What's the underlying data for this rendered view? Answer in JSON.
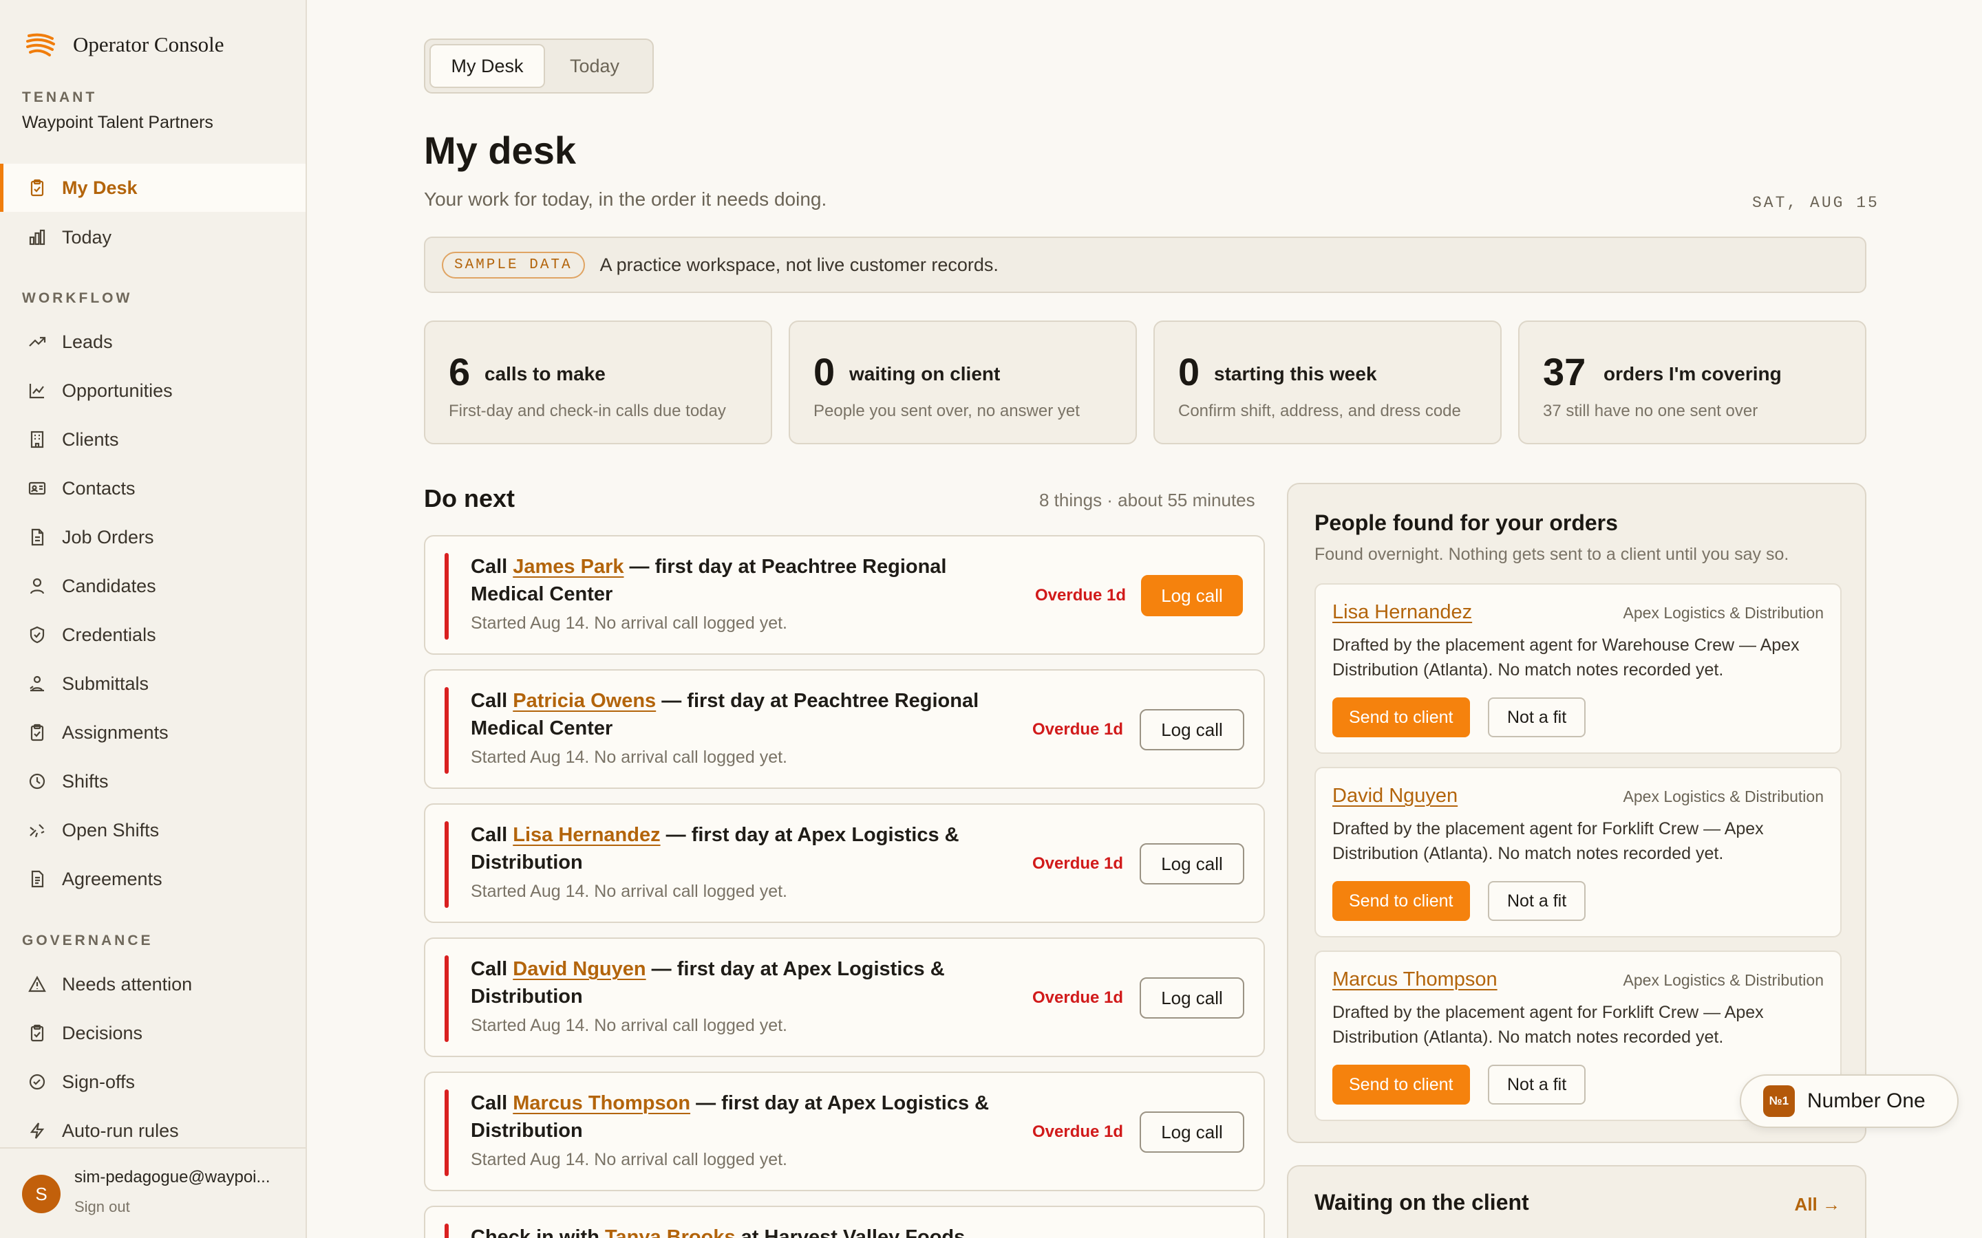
{
  "brand": {
    "name": "Operator Console",
    "accent": "#f07d0c"
  },
  "sidebar": {
    "tenant_label": "TENANT",
    "tenant_name": "Waypoint Talent Partners",
    "top_items": [
      {
        "label": "My Desk",
        "icon": "clipboard-icon",
        "active": true
      },
      {
        "label": "Today",
        "icon": "bar-chart-icon",
        "active": false
      }
    ],
    "workflow_label": "WORKFLOW",
    "workflow_items": [
      {
        "label": "Leads",
        "icon": "trending-up-icon"
      },
      {
        "label": "Opportunities",
        "icon": "line-chart-icon"
      },
      {
        "label": "Clients",
        "icon": "building-icon"
      },
      {
        "label": "Contacts",
        "icon": "id-card-icon"
      },
      {
        "label": "Job Orders",
        "icon": "document-icon"
      },
      {
        "label": "Candidates",
        "icon": "person-icon"
      },
      {
        "label": "Credentials",
        "icon": "shield-icon"
      },
      {
        "label": "Submittals",
        "icon": "user-send-icon"
      },
      {
        "label": "Assignments",
        "icon": "clipboard-check-icon"
      },
      {
        "label": "Shifts",
        "icon": "clock-icon"
      },
      {
        "label": "Open Shifts",
        "icon": "sparkle-icon"
      },
      {
        "label": "Agreements",
        "icon": "file-text-icon"
      }
    ],
    "governance_label": "GOVERNANCE",
    "governance_items": [
      {
        "label": "Needs attention",
        "icon": "warning-icon"
      },
      {
        "label": "Decisions",
        "icon": "clipboard-icon"
      },
      {
        "label": "Sign-offs",
        "icon": "check-circle-icon"
      },
      {
        "label": "Auto-run rules",
        "icon": "lightning-icon"
      }
    ],
    "user": {
      "initial": "S",
      "email": "sim-pedagogue@waypoi...",
      "sign_out": "Sign out"
    }
  },
  "tabs": [
    {
      "label": "My Desk",
      "active": true
    },
    {
      "label": "Today",
      "active": false
    }
  ],
  "page": {
    "title": "My desk",
    "subtitle": "Your work for today, in the order it needs doing.",
    "date": "SAT, AUG 15"
  },
  "banner": {
    "pill": "SAMPLE DATA",
    "text": "A practice workspace, not live customer records."
  },
  "stats": [
    {
      "num": "6",
      "label": "calls to make",
      "hint": "First-day and check-in calls due today"
    },
    {
      "num": "0",
      "label": "waiting on client",
      "hint": "People you sent over, no answer yet"
    },
    {
      "num": "0",
      "label": "starting this week",
      "hint": "Confirm shift, address, and dress code"
    },
    {
      "num": "37",
      "label": "orders I'm covering",
      "hint": "37 still have no one sent over"
    }
  ],
  "do_next": {
    "title": "Do next",
    "meta": "8 things · about 55 minutes",
    "tasks": [
      {
        "prefix": "Call ",
        "name": "James Park",
        "suffix": " — first day at Peachtree Regional Medical Center",
        "sub": "Started Aug 14. No arrival call logged yet.",
        "status": "Overdue 1d",
        "action": "Log call"
      },
      {
        "prefix": "Call ",
        "name": "Patricia Owens",
        "suffix": " — first day at Peachtree Regional Medical Center",
        "sub": "Started Aug 14. No arrival call logged yet.",
        "status": "Overdue 1d",
        "action": "Log call"
      },
      {
        "prefix": "Call ",
        "name": "Lisa Hernandez",
        "suffix": " — first day at Apex Logistics & Distribution",
        "sub": "Started Aug 14. No arrival call logged yet.",
        "status": "Overdue 1d",
        "action": "Log call"
      },
      {
        "prefix": "Call ",
        "name": "David Nguyen",
        "suffix": " — first day at Apex Logistics & Distribution",
        "sub": "Started Aug 14. No arrival call logged yet.",
        "status": "Overdue 1d",
        "action": "Log call"
      },
      {
        "prefix": "Call ",
        "name": "Marcus Thompson",
        "suffix": " — first day at Apex Logistics & Distribution",
        "sub": "Started Aug 14. No arrival call logged yet.",
        "status": "Overdue 1d",
        "action": "Log call"
      },
      {
        "prefix": "Check in with ",
        "name": "Tanya Brooks",
        "suffix": " at Harvest Valley Foods",
        "sub": "",
        "status": "",
        "action": ""
      }
    ]
  },
  "people_found": {
    "title": "People found for your orders",
    "subtitle": "Found overnight. Nothing gets sent to a client until you say so.",
    "send_label": "Send to client",
    "reject_label": "Not a fit",
    "candidates": [
      {
        "name": "Lisa Hernandez",
        "org": "Apex Logistics & Distribution",
        "desc": "Drafted by the placement agent for Warehouse Crew — Apex Distribution (Atlanta). No match notes recorded yet."
      },
      {
        "name": "David Nguyen",
        "org": "Apex Logistics & Distribution",
        "desc": "Drafted by the placement agent for Forklift Crew — Apex Distribution (Atlanta). No match notes recorded yet."
      },
      {
        "name": "Marcus Thompson",
        "org": "Apex Logistics & Distribution",
        "desc": "Drafted by the placement agent for Forklift Crew — Apex Distribution (Atlanta). No match notes recorded yet."
      }
    ]
  },
  "waiting": {
    "title": "Waiting on the client",
    "all_label": "All →"
  },
  "assistant": {
    "badge": "№1",
    "label": "Number One"
  }
}
